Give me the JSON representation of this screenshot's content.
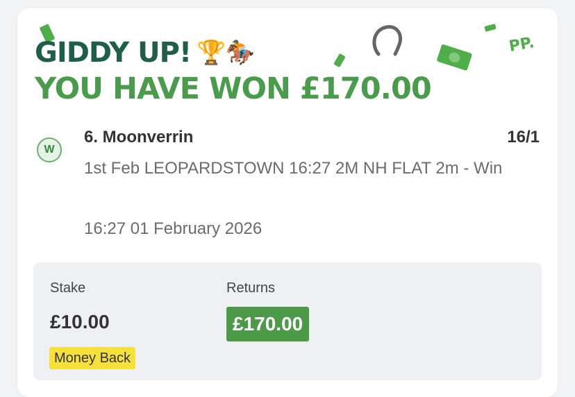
{
  "banner": {
    "line1": "GIDDY UP!",
    "line1_emojis": "🏆🏇",
    "line2": "YOU HAVE WON £170.00",
    "brand_mark": "PP.",
    "colors": {
      "dark_green": "#1f5f4a",
      "green": "#4a9b4b"
    }
  },
  "bet": {
    "result_badge": "W",
    "selection": "6. Moonverrin",
    "odds": "16/1",
    "market": "1st Feb LEOPARDSTOWN 16:27 2M NH FLAT 2m - Win",
    "datetime": "16:27 01 February 2026"
  },
  "summary": {
    "stake_label": "Stake",
    "stake_value": "£10.00",
    "returns_label": "Returns",
    "returns_value": "£170.00",
    "promo_tag": "Money Back",
    "colors": {
      "returns_bg": "#4c9a47",
      "promo_bg": "#f5e13a"
    }
  },
  "decorations": [
    "money-note-icon",
    "horseshoe-icon",
    "trophy-icon",
    "jockey-icon"
  ]
}
